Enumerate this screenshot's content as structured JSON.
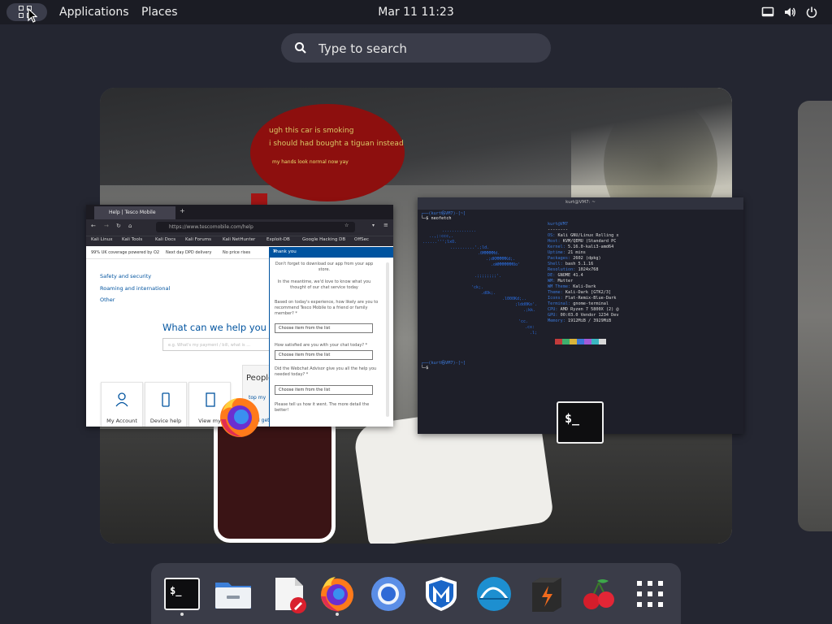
{
  "topbar": {
    "activities_icon": "activities-grid-icon",
    "applications_label": "Applications",
    "places_label": "Places",
    "clock": "Mar 11  11:23",
    "status_icons": [
      "screen-icon",
      "volume-icon",
      "power-icon"
    ]
  },
  "search": {
    "placeholder": "Type to search",
    "icon": "search-icon"
  },
  "workspace": {
    "meme_bubble": {
      "line1": "ugh this car is smoking",
      "line2": "i should had bought a tiguan instead",
      "line3": "my hands look normal now yay"
    }
  },
  "firefox_window": {
    "tab_title": "Help | Tesco Mobile",
    "new_tab": "+",
    "url": "https://www.tescomobile.com/help",
    "bookmarks": [
      "Kali Linux",
      "Kali Tools",
      "Kali Docs",
      "Kali Forums",
      "Kali NetHunter",
      "Exploit-DB",
      "Google Hacking DB",
      "OffSec"
    ],
    "info_strip": [
      "99% UK coverage powered by O2",
      "Next day DPD delivery",
      "No price rises"
    ],
    "sidebar_links": [
      "Safety and security",
      "Roaming and international",
      "Other"
    ],
    "help_heading": "What can we help you wi",
    "search_placeholder": "e.g. What's my payment / bill, what is ...",
    "cards": [
      "My Account",
      "Device help",
      "View my"
    ],
    "people_label": "People",
    "people_links": [
      "top my",
      "I get a PAC code?"
    ],
    "chat": {
      "title": "Thank you",
      "minimize": "–",
      "close": "✕",
      "intro": "Don't forget to download our app from your app store.",
      "intro2": "In the meantime, we'd love to know what you thought of our chat service today",
      "q1": "Based on today's experience, how likely are you to recommend Tesco Mobile to a friend or family member? *",
      "q2": "How satisfied are you with your chat today? *",
      "q3": "Did the Webchat Advisor give you all the help you needed today? *",
      "q4": "Please tell us how it went. The more detail the better!",
      "select_placeholder": "Choose item from the list"
    }
  },
  "terminal_window": {
    "title": "kurt@VM7: ~",
    "prompt1": "┌──(kurt㉿VM7)-[~]",
    "cmd1": "└─$ neofetch",
    "user_host": "kurt@VM7",
    "separator": "--------",
    "info": [
      "OS: Kali GNU/Linux Rolling x",
      "Host: KVM/QEMU (Standard PC",
      "Kernel: 5.16.0-kali3-amd64",
      "Uptime: 21 mins",
      "Packages: 2602 (dpkg)",
      "Shell: bash 5.1.16",
      "Resolution: 1024x768",
      "DE: GNOME 41.4",
      "WM: Mutter",
      "WM Theme: Kali-Dark",
      "Theme: Kali-Dark [GTK2/3]",
      "Icons: Flat-Remix-Blue-Dark",
      "Terminal: gnome-terminal",
      "CPU: AMD Ryzen 7 5800X (2) @",
      "GPU: 00:03.0 Vendor 1234 Dev",
      "Memory: 1912MiB / 3929MiB"
    ],
    "prompt2": "┌──(kurt㉿VM7)-[~]",
    "cmd2": "└─$ ",
    "palette_colors": [
      "#1e1f29",
      "#c23b3b",
      "#3eb06e",
      "#d8b43a",
      "#3b78d8",
      "#a35bd8",
      "#3bb8c2",
      "#d8d8d8"
    ],
    "overlay_icon_text": "$_"
  },
  "dock": {
    "apps": [
      {
        "name": "terminal-app-icon",
        "label": "$_",
        "running": true
      },
      {
        "name": "files-app-icon",
        "running": false
      },
      {
        "name": "text-editor-app-icon",
        "running": false
      },
      {
        "name": "firefox-app-icon",
        "running": true
      },
      {
        "name": "chromium-app-icon",
        "running": false
      },
      {
        "name": "metasploit-app-icon",
        "running": false
      },
      {
        "name": "wireshark-app-icon",
        "running": false
      },
      {
        "name": "burpsuite-app-icon",
        "running": false
      },
      {
        "name": "cherrytree-app-icon",
        "running": false
      },
      {
        "name": "show-apps-grid-icon",
        "running": false
      }
    ]
  },
  "colors": {
    "background": "#242631",
    "topbar": "#1b1c24",
    "accent_blue": "#00539f",
    "kali_blue": "#2a6de0"
  }
}
